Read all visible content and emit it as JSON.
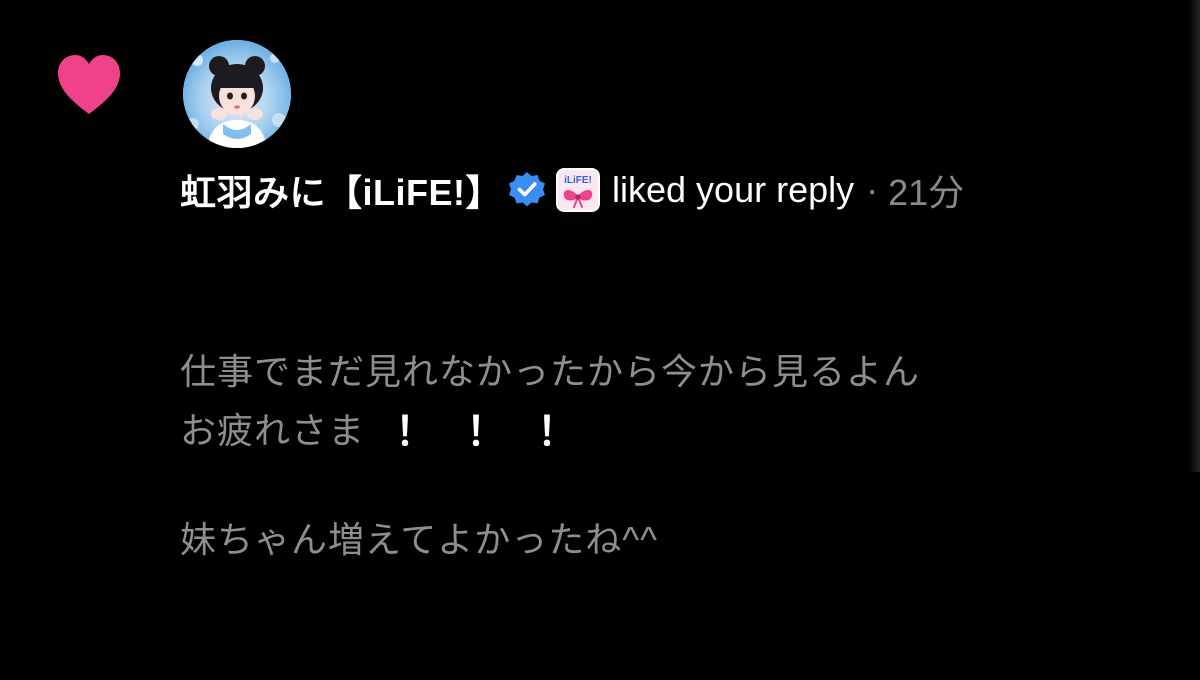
{
  "notification": {
    "icon": "heart-icon",
    "icon_color": "#F0428A",
    "avatar": "profile-avatar",
    "display_name": "虹羽みに【iLiFE!】",
    "verified_icon": "verified-badge-icon",
    "verified_color": "#3A8DF2",
    "affiliate_icon": "affiliate-badge-icon",
    "affiliate_text": "iLiFE!",
    "action": "liked your reply",
    "separator": "·",
    "time": "21分"
  },
  "reply": {
    "line1": "仕事でまだ見れなかったから今から見るよん",
    "line2": "妹ちゃん増えてよかったね^^",
    "line3": "お疲れさま",
    "exclamations": [
      "！",
      "！",
      "！"
    ]
  }
}
